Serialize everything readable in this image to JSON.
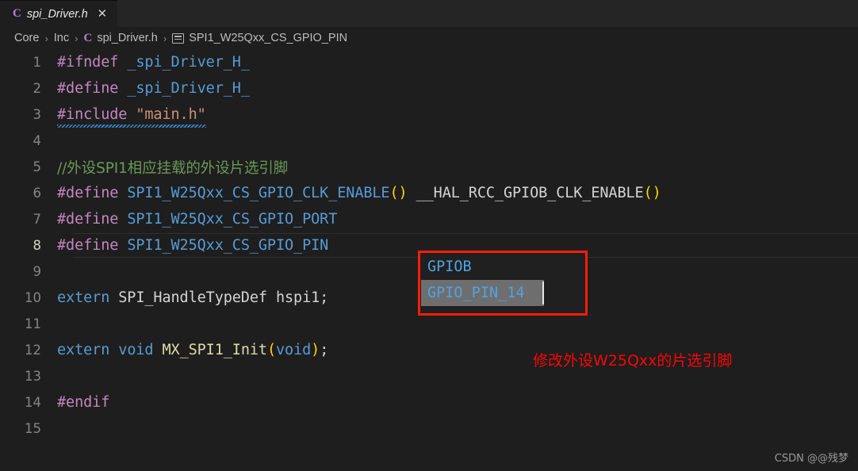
{
  "tab": {
    "lang_icon": "C",
    "title": "spi_Driver.h",
    "close_icon": "✕"
  },
  "breadcrumb": {
    "separator": "›",
    "items": [
      {
        "label": "Core",
        "icon": ""
      },
      {
        "label": "Inc",
        "icon": ""
      },
      {
        "label": "spi_Driver.h",
        "icon": "c-file-icon"
      },
      {
        "label": "SPI1_W25Qxx_CS_GPIO_PIN",
        "icon": "symbol-field-icon"
      }
    ]
  },
  "editor": {
    "active_line": 8,
    "lines": [
      {
        "num": "1",
        "tokens": [
          {
            "t": "#ifndef",
            "c": "pre"
          },
          {
            "t": " ",
            "c": "plain"
          },
          {
            "t": "_spi_Driver_H_",
            "c": "id"
          }
        ]
      },
      {
        "num": "2",
        "tokens": [
          {
            "t": "#define",
            "c": "pre"
          },
          {
            "t": " ",
            "c": "plain"
          },
          {
            "t": "_spi_Driver_H_",
            "c": "id"
          }
        ]
      },
      {
        "num": "3",
        "tokens": [
          {
            "t": "#include",
            "c": "pre"
          },
          {
            "t": " ",
            "c": "plain"
          },
          {
            "t": "\"main.h\"",
            "c": "str"
          }
        ],
        "squiggle": true
      },
      {
        "num": "4",
        "tokens": []
      },
      {
        "num": "5",
        "tokens": [
          {
            "t": "//外设SPI1相应挂载的外设片选引脚",
            "c": "cmt"
          }
        ]
      },
      {
        "num": "6",
        "tokens": [
          {
            "t": "#define",
            "c": "pre"
          },
          {
            "t": " ",
            "c": "plain"
          },
          {
            "t": "SPI1_W25Qxx_CS_GPIO_CLK_ENABLE",
            "c": "id"
          },
          {
            "t": "()",
            "c": "paren"
          },
          {
            "t": " __HAL_RCC_GPIOB_CLK_ENABLE",
            "c": "plain"
          },
          {
            "t": "()",
            "c": "paren"
          }
        ]
      },
      {
        "num": "7",
        "tokens": [
          {
            "t": "#define",
            "c": "pre"
          },
          {
            "t": " ",
            "c": "plain"
          },
          {
            "t": "SPI1_W25Qxx_CS_GPIO_PORT",
            "c": "id"
          }
        ]
      },
      {
        "num": "8",
        "tokens": [
          {
            "t": "#define",
            "c": "pre"
          },
          {
            "t": " ",
            "c": "plain"
          },
          {
            "t": "SPI1_W25Qxx_CS_GPIO_PIN",
            "c": "id"
          }
        ]
      },
      {
        "num": "9",
        "tokens": []
      },
      {
        "num": "10",
        "tokens": [
          {
            "t": "extern",
            "c": "kw"
          },
          {
            "t": " SPI_HandleTypeDef hspi1;",
            "c": "plain"
          }
        ]
      },
      {
        "num": "11",
        "tokens": []
      },
      {
        "num": "12",
        "tokens": [
          {
            "t": "extern",
            "c": "kw"
          },
          {
            "t": " ",
            "c": "plain"
          },
          {
            "t": "void",
            "c": "kw"
          },
          {
            "t": " ",
            "c": "plain"
          },
          {
            "t": "MX_SPI1_Init",
            "c": "fn"
          },
          {
            "t": "(",
            "c": "paren"
          },
          {
            "t": "void",
            "c": "kw"
          },
          {
            "t": ")",
            "c": "paren"
          },
          {
            "t": ";",
            "c": "plain"
          }
        ]
      },
      {
        "num": "13",
        "tokens": []
      },
      {
        "num": "14",
        "tokens": [
          {
            "t": "#endif",
            "c": "pre"
          }
        ]
      },
      {
        "num": "15",
        "tokens": []
      }
    ]
  },
  "suggestion_widget": {
    "highlight_border_color": "#ff1d07",
    "rows": [
      {
        "text": "GPIOB",
        "selected": false
      },
      {
        "text": "GPIO_PIN_14",
        "selected": true
      }
    ]
  },
  "annotation": {
    "text": "修改外设W25Qxx的片选引脚",
    "color": "#fb0604"
  },
  "watermark": {
    "text": "CSDN @@残梦"
  }
}
